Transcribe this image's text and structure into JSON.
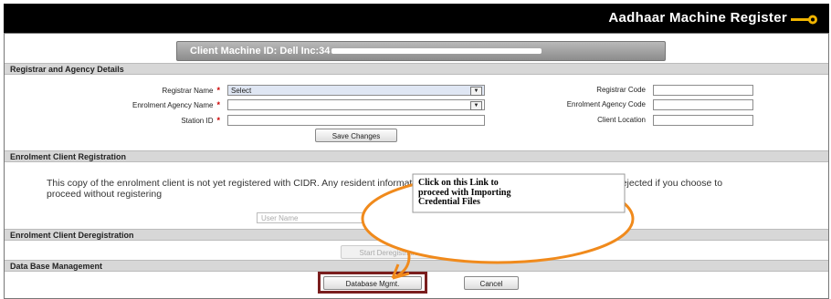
{
  "app": {
    "title": "Aadhaar Machine Register"
  },
  "client_machine": {
    "label": "Client Machine ID: Dell Inc:34"
  },
  "sections": {
    "registrar": "Registrar and Agency Details",
    "enrolment_registration": "Enrolment Client Registration",
    "enrolment_deregistration": "Enrolment Client Deregistration",
    "database": "Data Base Management"
  },
  "form": {
    "registrar_name_label": "Registrar Name",
    "registrar_name_value": "Select",
    "enrolment_agency_label": "Enrolment Agency Name",
    "enrolment_agency_value": "",
    "station_id_label": "Station ID",
    "station_id_value": "",
    "registrar_code_label": "Registrar Code",
    "enrolment_agency_code_label": "Enrolment Agency Code",
    "client_location_label": "Client Location",
    "required_marker": "*",
    "save_button": "Save Changes"
  },
  "registration": {
    "message": "This copy of the enrolment client is not yet registered with CIDR. Any resident information captured with this client will be subsequently rejected if you choose to proceed without registering",
    "username_placeholder": "User Name"
  },
  "deregistration": {
    "button": "Start Deregistration"
  },
  "database": {
    "db_button": "Database Mgmt.",
    "cancel_button": "Cancel"
  },
  "callout": {
    "line1": "Click on this Link to",
    "line2": "proceed with Importing",
    "line3": "Credential Files"
  },
  "colors": {
    "callout_orange": "#f08a1c",
    "highlight_border": "#7a1e1e",
    "required_red": "#cc0000"
  },
  "icons": {
    "title_icon": "key-icon",
    "dropdown_icon": "chevron-down-icon"
  }
}
